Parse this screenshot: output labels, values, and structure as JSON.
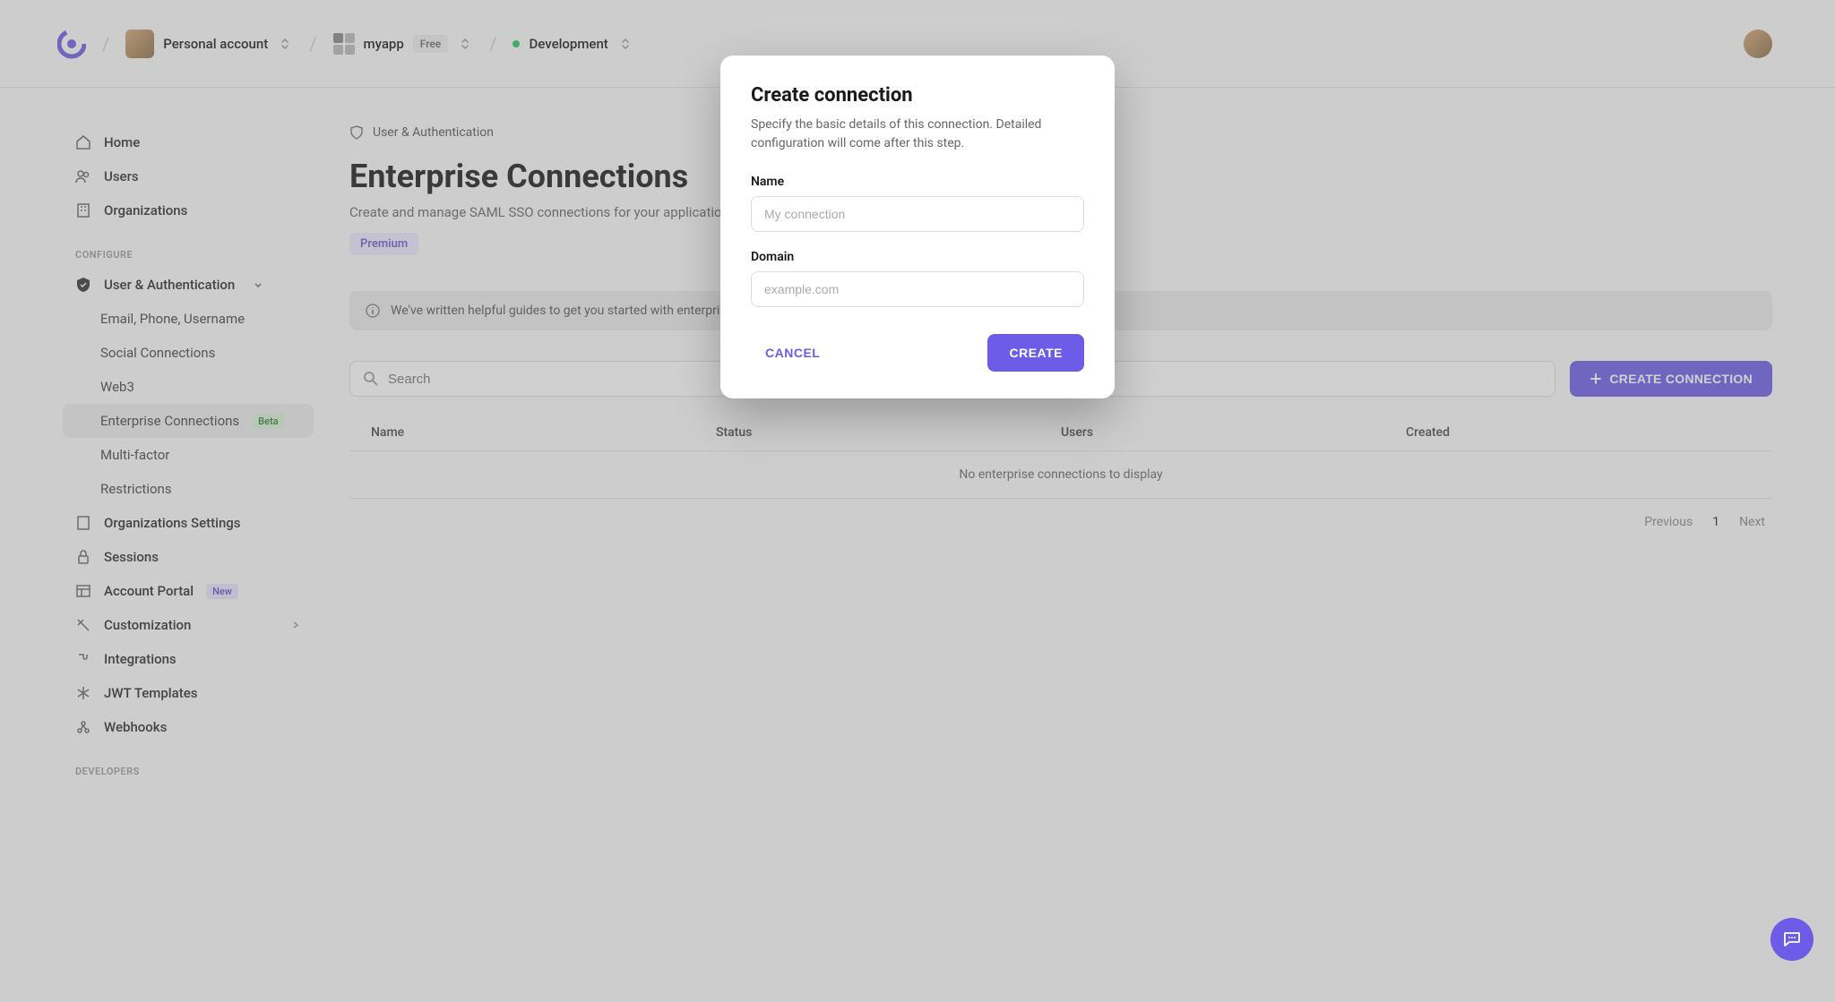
{
  "topbar": {
    "account_label": "Personal account",
    "app_label": "myapp",
    "app_badge": "Free",
    "env_label": "Development"
  },
  "sidebar": {
    "home": "Home",
    "users": "Users",
    "organizations": "Organizations",
    "section_configure": "CONFIGURE",
    "user_auth": "User & Authentication",
    "email_phone": "Email, Phone, Username",
    "social": "Social Connections",
    "web3": "Web3",
    "enterprise": "Enterprise Connections",
    "enterprise_badge": "Beta",
    "multifactor": "Multi-factor",
    "restrictions": "Restrictions",
    "org_settings": "Organizations Settings",
    "sessions": "Sessions",
    "account_portal": "Account Portal",
    "account_portal_badge": "New",
    "customization": "Customization",
    "integrations": "Integrations",
    "jwt": "JWT Templates",
    "webhooks": "Webhooks",
    "section_developers": "DEVELOPERS"
  },
  "main": {
    "breadcrumb_root": "User & Authentication",
    "title": "Enterprise Connections",
    "description": "Create and manage SAML SSO connections for your application.",
    "premium_badge": "Premium",
    "info_banner": "We've written helpful guides to get you started with enterprise connections.",
    "search_placeholder": "Search",
    "create_btn": "CREATE CONNECTION",
    "columns": {
      "name": "Name",
      "status": "Status",
      "users": "Users",
      "created": "Created"
    },
    "empty": "No enterprise connections to display",
    "pagination": {
      "prev": "Previous",
      "page": "1",
      "next": "Next"
    }
  },
  "modal": {
    "title": "Create connection",
    "description": "Specify the basic details of this connection. Detailed configuration will come after this step.",
    "name_label": "Name",
    "name_placeholder": "My connection",
    "domain_label": "Domain",
    "domain_placeholder": "example.com",
    "cancel": "CANCEL",
    "create": "CREATE"
  }
}
